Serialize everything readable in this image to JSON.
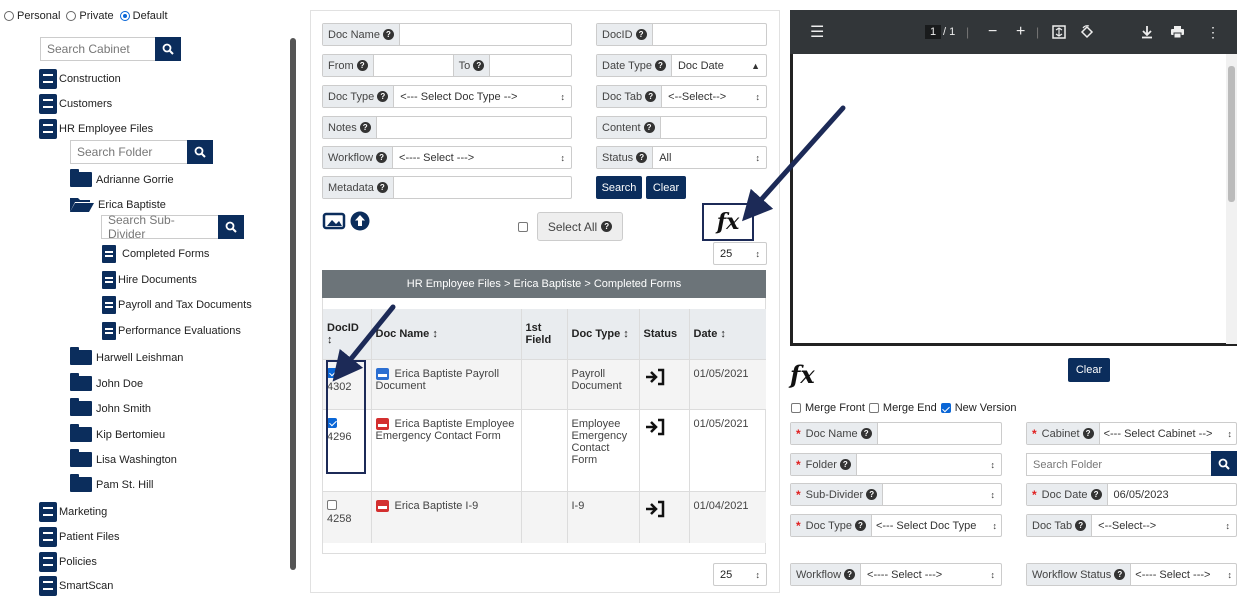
{
  "scope": {
    "options": [
      "Personal",
      "Private",
      "Default"
    ],
    "selected": "Default"
  },
  "cabinet_search": {
    "placeholder": "Search Cabinet"
  },
  "cabinets": {
    "construction": "Construction",
    "customers": "Customers",
    "hr": "HR Employee Files",
    "marketing": "Marketing",
    "patient": "Patient Files",
    "policies": "Policies",
    "smartscan": "SmartScan"
  },
  "folder_search": {
    "placeholder": "Search Folder"
  },
  "folders": {
    "adrianne": "Adrianne Gorrie",
    "erica": "Erica Baptiste",
    "harwell": "Harwell Leishman",
    "johndoe": "John Doe",
    "johnsmith": "John Smith",
    "kip": "Kip Bertomieu",
    "lisa": "Lisa Washington",
    "pam": "Pam St. Hill"
  },
  "subdivider_search": {
    "placeholder": "Search Sub-Divider"
  },
  "subdividers": {
    "completed": "Completed Forms",
    "hire": "Hire Documents",
    "payroll": "Payroll and Tax Documents",
    "performance": "Performance Evaluations"
  },
  "search_form": {
    "doc_name": "Doc Name",
    "docid": "DocID",
    "from": "From",
    "to": "To",
    "date_type": "Date Type",
    "date_type_value": "Doc Date",
    "doc_type": "Doc Type",
    "doc_type_value": "<--- Select Doc Type -->",
    "doc_tab": "Doc Tab",
    "doc_tab_value": "<--Select-->",
    "notes": "Notes",
    "content": "Content",
    "workflow": "Workflow",
    "workflow_value": "<---- Select --->",
    "status": "Status",
    "status_value": "All",
    "metadata": "Metadata",
    "search_btn": "Search",
    "clear_btn": "Clear",
    "select_all": "Select All",
    "page_size": "25"
  },
  "results": {
    "breadcrumb": "HR Employee Files > Erica Baptiste > Completed Forms",
    "headers": {
      "docid": "DocID",
      "docname": "Doc Name",
      "first": "1st Field",
      "doctype": "Doc Type",
      "status": "Status",
      "date": "Date"
    },
    "rows": [
      {
        "id": "4302",
        "name": "Erica Baptiste Payroll Document",
        "first": "",
        "type": "Payroll Document",
        "date": "01/05/2021",
        "checked": true
      },
      {
        "id": "4296",
        "name": "Erica Baptiste Employee Emergency Contact Form",
        "first": "",
        "type": "Employee Emergency Contact Form",
        "date": "01/05/2021",
        "checked": true
      },
      {
        "id": "4258",
        "name": "Erica Baptiste I-9",
        "first": "",
        "type": "I-9",
        "date": "01/04/2021",
        "checked": false
      }
    ],
    "page_size": "25"
  },
  "pdf_viewer": {
    "page": "1",
    "total": "/ 1"
  },
  "merge_form": {
    "fx": "fx",
    "clear": "Clear",
    "merge_front": "Merge Front",
    "merge_end": "Merge End",
    "new_version": "New Version",
    "doc_name": "Doc Name",
    "cabinet": "Cabinet",
    "cabinet_value": "<--- Select Cabinet -->",
    "folder": "Folder",
    "folder_search": "Search Folder",
    "sub_divider": "Sub-Divider",
    "doc_date": "Doc Date",
    "doc_date_value": "06/05/2023",
    "doc_type": "Doc Type",
    "doc_type_value": "<--- Select Doc Type",
    "doc_tab": "Doc Tab",
    "doc_tab_value": "<--Select-->",
    "workflow": "Workflow",
    "workflow_value": "<---- Select --->",
    "workflow_status": "Workflow Status",
    "workflow_status_value": "<---- Select --->"
  },
  "colors": {
    "brand": "#0b2d5c",
    "annotation": "#1c2a57",
    "checkbox": "#0a66d6"
  }
}
